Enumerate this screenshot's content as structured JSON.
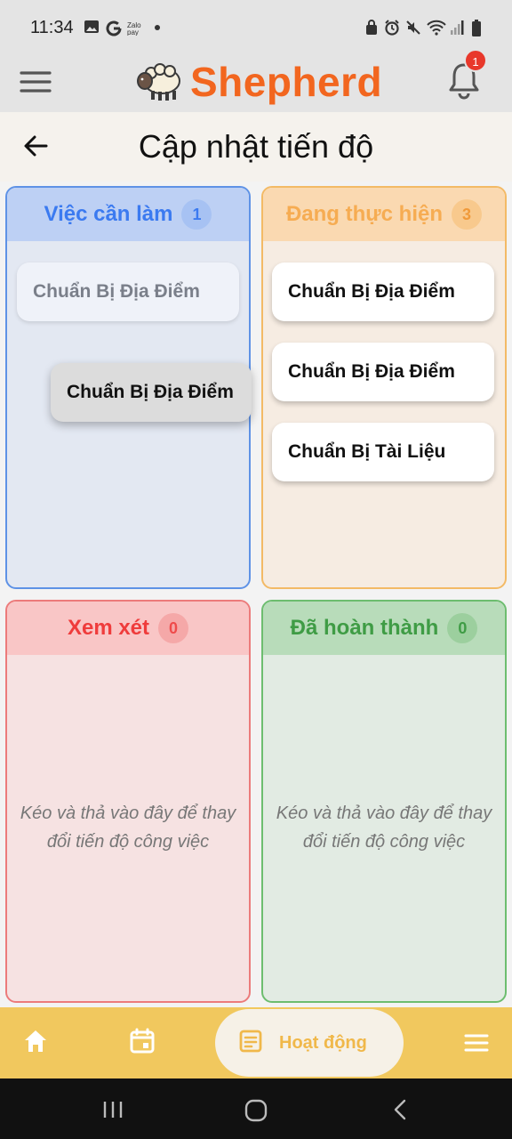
{
  "status_bar": {
    "time": "11:34",
    "left_icons": [
      "gallery-icon",
      "google-icon",
      "zalopay-icon",
      "dot-icon"
    ],
    "right_icons": [
      "lock-icon",
      "alarm-icon",
      "mute-icon",
      "wifi-icon",
      "signal-icon",
      "battery-icon"
    ]
  },
  "app_bar": {
    "brand": "Shepherd",
    "notification_count": "1"
  },
  "header": {
    "title": "Cập nhật tiến độ"
  },
  "columns": {
    "todo": {
      "title": "Việc cần làm",
      "count": "1",
      "cards": [
        "Chuẩn Bị Địa Điểm"
      ],
      "dragging_card": "Chuẩn Bị Địa Điểm"
    },
    "in_progress": {
      "title": "Đang thực hiện",
      "count": "3",
      "cards": [
        "Chuẩn Bị Địa Điểm",
        "Chuẩn Bị Địa Điểm",
        "Chuẩn Bị Tài Liệu"
      ]
    },
    "review": {
      "title": "Xem xét",
      "count": "0",
      "empty_hint": "Kéo và thả vào đây để thay đổi tiến độ công việc"
    },
    "done": {
      "title": "Đã hoàn thành",
      "count": "0",
      "empty_hint": "Kéo và thả vào đây để thay đổi tiến độ công việc"
    }
  },
  "bottom_nav": {
    "active_label": "Hoạt động",
    "items": [
      "home-icon",
      "calendar-icon",
      "activity-icon",
      "menu-icon"
    ]
  },
  "colors": {
    "brand": "#f2661f",
    "todo": "#3b7af0",
    "in_progress": "#f6ac52",
    "review": "#ef3c3c",
    "done": "#3f9c45",
    "nav": "#f1c85e"
  }
}
